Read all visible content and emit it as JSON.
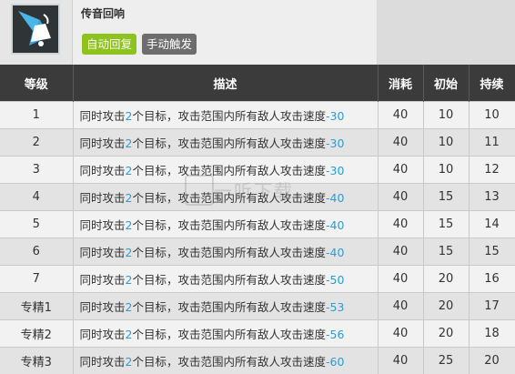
{
  "skill": {
    "icon": "bell-icon",
    "name": "传音回响",
    "tags": [
      "自动回复",
      "手动触发"
    ]
  },
  "table": {
    "headers": [
      "等级",
      "描述",
      "消耗",
      "初始",
      "持续"
    ],
    "rows": [
      {
        "level": "1",
        "d1": "同时攻击",
        "d2": "2",
        "d3": "个目标，攻击范围内所有敌人攻击速度",
        "d4": "-30",
        "cost": "40",
        "init": "10",
        "dur": "10"
      },
      {
        "level": "2",
        "d1": "同时攻击",
        "d2": "2",
        "d3": "个目标，攻击范围内所有敌人攻击速度",
        "d4": "-30",
        "cost": "40",
        "init": "10",
        "dur": "11"
      },
      {
        "level": "3",
        "d1": "同时攻击",
        "d2": "2",
        "d3": "个目标，攻击范围内所有敌人攻击速度",
        "d4": "-30",
        "cost": "40",
        "init": "10",
        "dur": "12"
      },
      {
        "level": "4",
        "d1": "同时攻击",
        "d2": "2",
        "d3": "个目标，攻击范围内所有敌人攻击速度",
        "d4": "-40",
        "cost": "40",
        "init": "15",
        "dur": "13"
      },
      {
        "level": "5",
        "d1": "同时攻击",
        "d2": "2",
        "d3": "个目标，攻击范围内所有敌人攻击速度",
        "d4": "-40",
        "cost": "40",
        "init": "15",
        "dur": "14"
      },
      {
        "level": "6",
        "d1": "同时攻击",
        "d2": "2",
        "d3": "个目标，攻击范围内所有敌人攻击速度",
        "d4": "-40",
        "cost": "40",
        "init": "15",
        "dur": "15"
      },
      {
        "level": "7",
        "d1": "同时攻击",
        "d2": "2",
        "d3": "个目标，攻击范围内所有敌人攻击速度",
        "d4": "-50",
        "cost": "40",
        "init": "20",
        "dur": "16"
      },
      {
        "level": "专精1",
        "d1": "同时攻击",
        "d2": "2",
        "d3": "个目标，攻击范围内所有敌人攻击速度",
        "d4": "-53",
        "cost": "40",
        "init": "20",
        "dur": "17"
      },
      {
        "level": "专精2",
        "d1": "同时攻击",
        "d2": "2",
        "d3": "个目标，攻击范围内所有敌人攻击速度",
        "d4": "-56",
        "cost": "40",
        "init": "20",
        "dur": "18"
      },
      {
        "level": "专精3",
        "d1": "同时攻击",
        "d2": "2",
        "d3": "个目标，攻击范围内所有敌人攻击速度",
        "d4": "-60",
        "cost": "40",
        "init": "25",
        "dur": "20"
      }
    ]
  },
  "watermark": {
    "text": "一听下载"
  },
  "colors": {
    "accent_number": "#2e9ad6",
    "tag_auto": "#8dc21f",
    "tag_manual": "#6d6d6d",
    "header_bg": "#3b3b3b"
  }
}
